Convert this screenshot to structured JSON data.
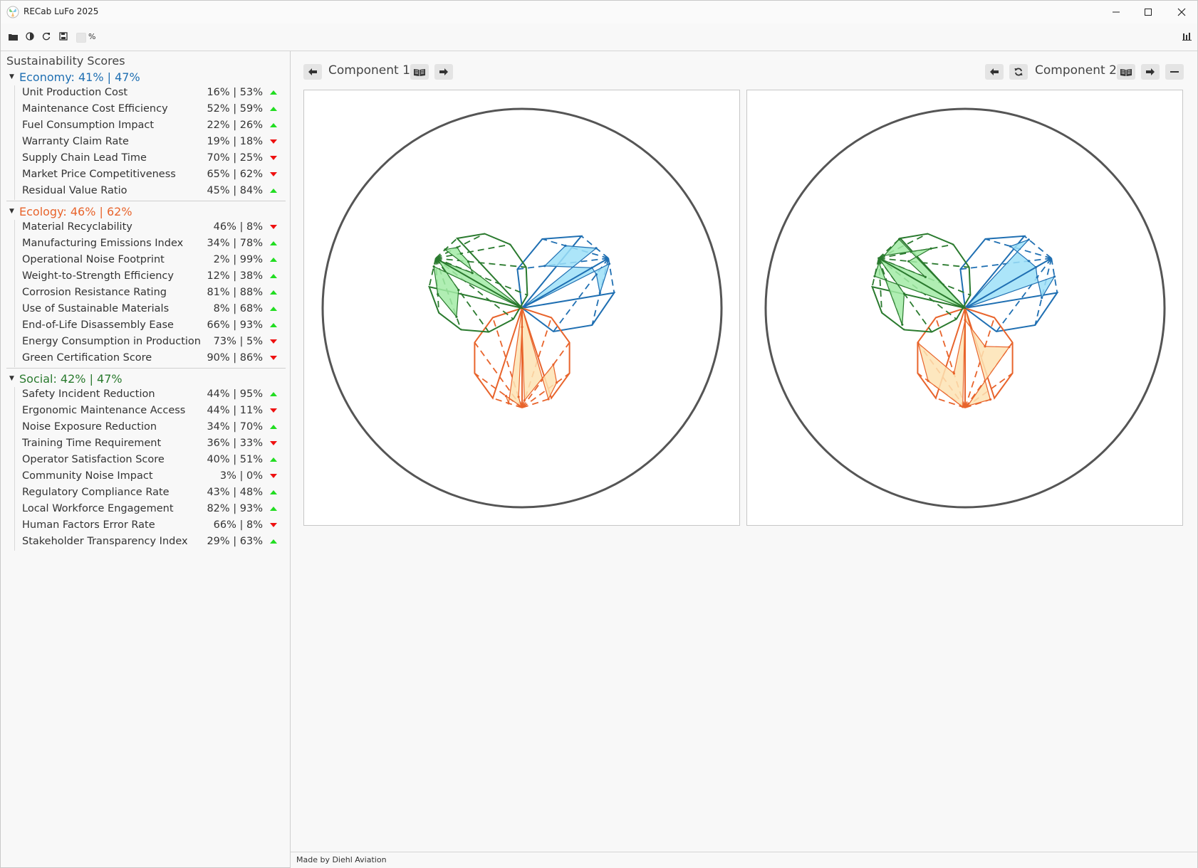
{
  "window": {
    "title": "RECab LuFo 2025"
  },
  "toolbar": {
    "percent_label": "%"
  },
  "sidebar": {
    "title": "Sustainability Scores",
    "categories": [
      {
        "header": "Economy: 41% | 47%",
        "color": "#1f6fb2",
        "items": [
          {
            "label": "Unit Production Cost",
            "value": "16% | 53%",
            "trend": "up"
          },
          {
            "label": "Maintenance Cost Efficiency",
            "value": "52% | 59%",
            "trend": "up"
          },
          {
            "label": "Fuel Consumption Impact",
            "value": "22% | 26%",
            "trend": "up"
          },
          {
            "label": "Warranty Claim Rate",
            "value": "19% | 18%",
            "trend": "down"
          },
          {
            "label": "Supply Chain Lead Time",
            "value": "70% | 25%",
            "trend": "down"
          },
          {
            "label": "Market Price Competitiveness",
            "value": "65% | 62%",
            "trend": "down"
          },
          {
            "label": "Residual Value Ratio",
            "value": "45% | 84%",
            "trend": "up"
          }
        ]
      },
      {
        "header": "Ecology: 46% | 62%",
        "color": "#e8642c",
        "items": [
          {
            "label": "Material Recyclability",
            "value": "46% | 8%",
            "trend": "down"
          },
          {
            "label": "Manufacturing Emissions Index",
            "value": "34% | 78%",
            "trend": "up"
          },
          {
            "label": "Operational Noise Footprint",
            "value": "2% | 99%",
            "trend": "up"
          },
          {
            "label": "Weight-to-Strength Efficiency",
            "value": "12% | 38%",
            "trend": "up"
          },
          {
            "label": "Corrosion Resistance Rating",
            "value": "81% | 88%",
            "trend": "up"
          },
          {
            "label": "Use of Sustainable Materials",
            "value": "8% | 68%",
            "trend": "up"
          },
          {
            "label": "End-of-Life Disassembly Ease",
            "value": "66% | 93%",
            "trend": "up"
          },
          {
            "label": "Energy Consumption in Production",
            "value": "73% | 5%",
            "trend": "down"
          },
          {
            "label": "Green Certification Score",
            "value": "90% | 86%",
            "trend": "down"
          }
        ]
      },
      {
        "header": "Social: 42% | 47%",
        "color": "#2a7a2e",
        "items": [
          {
            "label": "Safety Incident Reduction",
            "value": "44% | 95%",
            "trend": "up"
          },
          {
            "label": "Ergonomic Maintenance Access",
            "value": "44% | 11%",
            "trend": "down"
          },
          {
            "label": "Noise Exposure Reduction",
            "value": "34% | 70%",
            "trend": "up"
          },
          {
            "label": "Training Time Requirement",
            "value": "36% | 33%",
            "trend": "down"
          },
          {
            "label": "Operator Satisfaction Score",
            "value": "40% | 51%",
            "trend": "up"
          },
          {
            "label": "Community Noise Impact",
            "value": "3% | 0%",
            "trend": "down"
          },
          {
            "label": "Regulatory Compliance Rate",
            "value": "43% | 48%",
            "trend": "up"
          },
          {
            "label": "Local Workforce Engagement",
            "value": "82% | 93%",
            "trend": "up"
          },
          {
            "label": "Human Factors Error Rate",
            "value": "66% | 8%",
            "trend": "down"
          },
          {
            "label": "Stakeholder Transparency Index",
            "value": "29% | 63%",
            "trend": "up"
          }
        ]
      }
    ]
  },
  "components": [
    {
      "label": "Component 1"
    },
    {
      "label": "Component 2"
    }
  ],
  "chart_data": [
    {
      "type": "radar",
      "title": "",
      "ylim": [
        0,
        100
      ],
      "series": [
        {
          "category": "Economy",
          "color": "#1f6fb2",
          "fill": "#9de0f8",
          "direction_deg": 330,
          "values": [
            16,
            52,
            22,
            19,
            70,
            65,
            45
          ]
        },
        {
          "category": "Ecology",
          "color": "#e8642c",
          "fill": "#fde3b4",
          "direction_deg": 90,
          "values": [
            46,
            34,
            2,
            12,
            81,
            8,
            66,
            73,
            90
          ]
        },
        {
          "category": "Social",
          "color": "#2a7a2e",
          "fill": "#a2eba6",
          "direction_deg": 210,
          "values": [
            44,
            44,
            34,
            36,
            40,
            3,
            43,
            82,
            66,
            29
          ]
        }
      ]
    },
    {
      "type": "radar",
      "title": "",
      "ylim": [
        0,
        100
      ],
      "series": [
        {
          "category": "Economy",
          "color": "#1f6fb2",
          "fill": "#9de0f8",
          "direction_deg": 330,
          "values": [
            53,
            59,
            26,
            18,
            25,
            62,
            84
          ]
        },
        {
          "category": "Ecology",
          "color": "#e8642c",
          "fill": "#fde3b4",
          "direction_deg": 90,
          "values": [
            8,
            78,
            99,
            38,
            88,
            68,
            93,
            5,
            86
          ]
        },
        {
          "category": "Social",
          "color": "#2a7a2e",
          "fill": "#a2eba6",
          "direction_deg": 210,
          "values": [
            95,
            11,
            70,
            33,
            51,
            0,
            48,
            93,
            8,
            63
          ]
        }
      ]
    }
  ],
  "footer": {
    "text": "Made by Diehl Aviation"
  }
}
